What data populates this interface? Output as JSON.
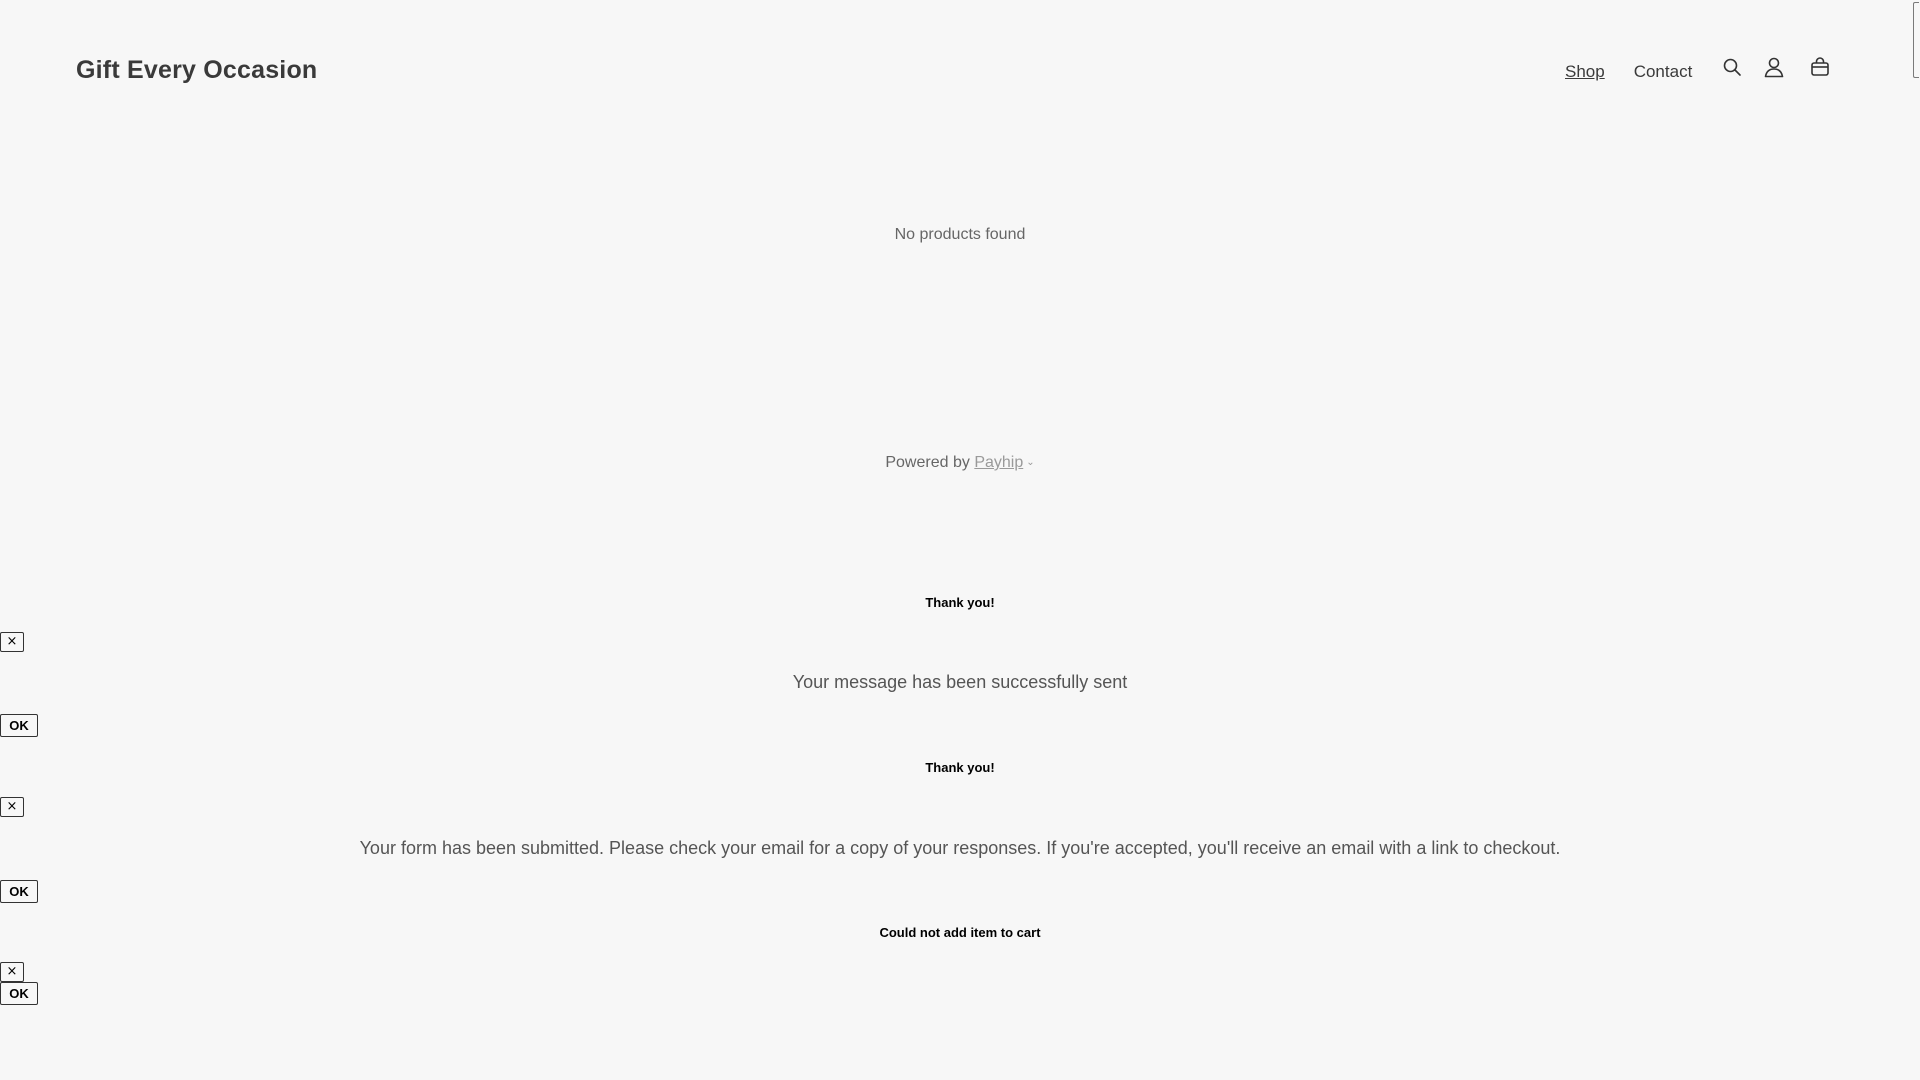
{
  "header": {
    "logo": "Gift Every Occasion",
    "nav": [
      {
        "label": "Shop"
      },
      {
        "label": "Contact"
      }
    ],
    "icons": [
      "search-icon",
      "account-icon",
      "cart-icon"
    ]
  },
  "main": {
    "empty_message": "No products found"
  },
  "footer": {
    "powered_prefix": "Powered by",
    "powered_link": "Payhip"
  },
  "modals": [
    {
      "title": "Thank you!",
      "close_label": "×",
      "message": "Your message has been successfully sent",
      "ok_label": "OK"
    },
    {
      "title": "Thank you!",
      "close_label": "×",
      "message": "Your form has been submitted. Please check your email for a copy of your responses. If you're accepted, you'll receive an email with a link to checkout.",
      "ok_label": "OK"
    },
    {
      "title": "Could not add item to cart",
      "close_label": "×",
      "ok_label": "OK"
    }
  ],
  "colors": {
    "background": "#f7f7f7",
    "text": "#3a3a3a",
    "muted": "#666666"
  }
}
